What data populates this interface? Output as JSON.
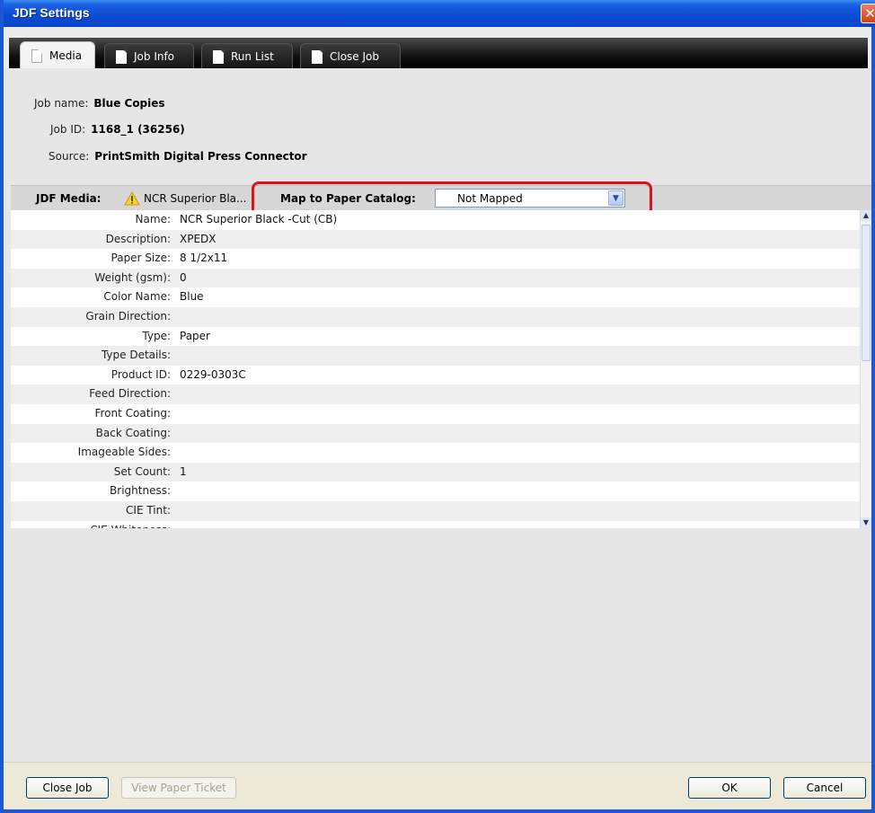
{
  "window": {
    "title": "JDF Settings",
    "close_glyph": "✕"
  },
  "tabs": [
    {
      "label": "Media",
      "active": true
    },
    {
      "label": "Job Info",
      "active": false
    },
    {
      "label": "Run List",
      "active": false
    },
    {
      "label": "Close Job",
      "active": false
    }
  ],
  "job": {
    "name_label": "Job name:",
    "name_value": "Blue Copies",
    "id_label": "Job ID:",
    "id_value": "1168_1 (36256)",
    "source_label": "Source:",
    "source_value": "PrintSmith Digital Press Connector"
  },
  "media_bar": {
    "label": "JDF Media:",
    "warning_icon": "warning-icon",
    "media_name": "NCR Superior Bla...",
    "map_label": "Map to Paper Catalog:",
    "map_value": "Not Mapped"
  },
  "properties": [
    {
      "label": "Name:",
      "value": "NCR Superior Black -Cut (CB)"
    },
    {
      "label": "Description:",
      "value": "XPEDX"
    },
    {
      "label": "Paper Size:",
      "value": "8 1/2x11"
    },
    {
      "label": "Weight (gsm):",
      "value": "0"
    },
    {
      "label": "Color Name:",
      "value": "Blue"
    },
    {
      "label": "Grain Direction:",
      "value": ""
    },
    {
      "label": "Type:",
      "value": "Paper"
    },
    {
      "label": "Type Details:",
      "value": ""
    },
    {
      "label": "Product ID:",
      "value": "0229-0303C"
    },
    {
      "label": "Feed Direction:",
      "value": ""
    },
    {
      "label": "Front Coating:",
      "value": ""
    },
    {
      "label": "Back Coating:",
      "value": ""
    },
    {
      "label": "Imageable Sides:",
      "value": ""
    },
    {
      "label": "Set Count:",
      "value": "1"
    },
    {
      "label": "Brightness:",
      "value": ""
    },
    {
      "label": "CIE Tint:",
      "value": ""
    },
    {
      "label": "CIE Whiteness:",
      "value": ""
    }
  ],
  "footer": {
    "close_job": "Close Job",
    "view_ticket": "View Paper Ticket",
    "ok": "OK",
    "cancel": "Cancel"
  },
  "colors": {
    "highlight": "#e3101c",
    "titlebar": "#0a4ad3"
  }
}
